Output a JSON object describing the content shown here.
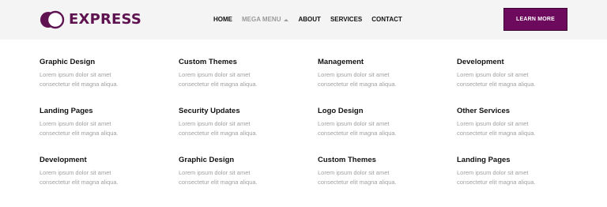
{
  "brand": {
    "name": "EXPRESS",
    "color": "#5e1250"
  },
  "nav": {
    "items": [
      {
        "label": "HOME",
        "active": false
      },
      {
        "label": "MEGA MENU",
        "active": true
      },
      {
        "label": "ABOUT",
        "active": false
      },
      {
        "label": "SERVICES",
        "active": false
      },
      {
        "label": "CONTACT",
        "active": false
      }
    ]
  },
  "cta": {
    "label": "LEARN MORE",
    "color": "#6d0a5e"
  },
  "mega_menu": {
    "items": [
      {
        "title": "Graphic Design",
        "desc": "Lorem ipsum dolor sit amet consectetur elit magna aliqua."
      },
      {
        "title": "Custom Themes",
        "desc": "Lorem ipsum dolor sit amet consectetur elit magna aliqua."
      },
      {
        "title": "Management",
        "desc": "Lorem ipsum dolor sit amet consectetur elit magna aliqua."
      },
      {
        "title": "Development",
        "desc": "Lorem ipsum dolor sit amet consectetur elit magna aliqua."
      },
      {
        "title": "Landing Pages",
        "desc": "Lorem ipsum dolor sit amet consectetur elit magna aliqua."
      },
      {
        "title": "Security Updates",
        "desc": "Lorem ipsum dolor sit amet consectetur elit magna aliqua."
      },
      {
        "title": "Logo Design",
        "desc": "Lorem ipsum dolor sit amet consectetur elit magna aliqua."
      },
      {
        "title": "Other Services",
        "desc": "Lorem ipsum dolor sit amet consectetur elit magna aliqua."
      },
      {
        "title": "Development",
        "desc": "Lorem ipsum dolor sit amet consectetur elit magna aliqua."
      },
      {
        "title": "Graphic Design",
        "desc": "Lorem ipsum dolor sit amet consectetur elit magna aliqua."
      },
      {
        "title": "Custom Themes",
        "desc": "Lorem ipsum dolor sit amet consectetur elit magna aliqua."
      },
      {
        "title": "Landing Pages",
        "desc": "Lorem ipsum dolor sit amet consectetur elit magna aliqua."
      }
    ]
  }
}
